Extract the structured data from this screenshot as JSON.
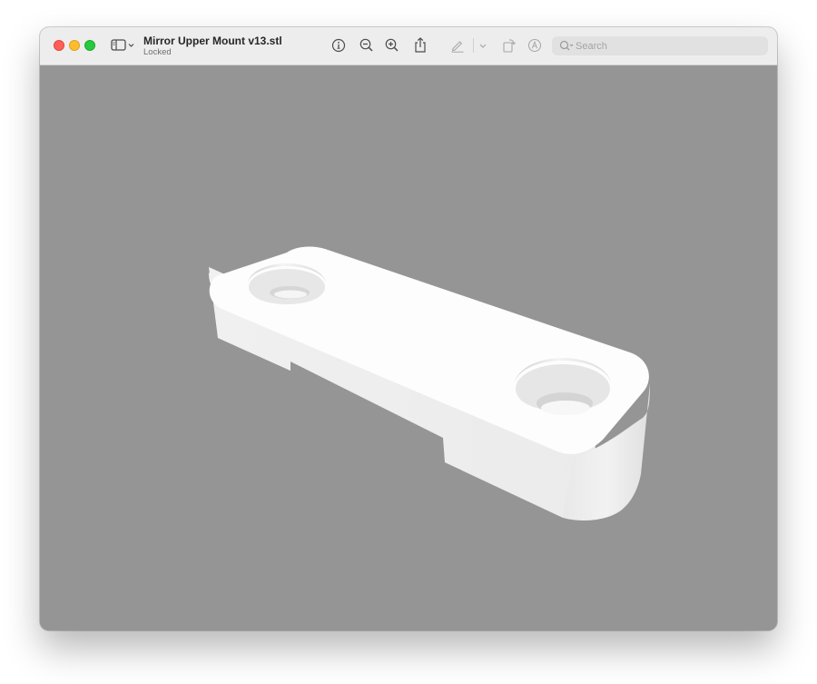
{
  "window": {
    "title": "Mirror Upper Mount v13.stl",
    "subtitle": "Locked"
  },
  "toolbar": {
    "buttons": [
      {
        "name": "info",
        "icon": "info-circle-icon"
      },
      {
        "name": "zoom-out",
        "icon": "zoom-out-icon"
      },
      {
        "name": "zoom-in",
        "icon": "zoom-in-icon"
      },
      {
        "name": "share",
        "icon": "share-icon"
      },
      {
        "name": "markup",
        "icon": "pen-icon",
        "enabled": false
      },
      {
        "name": "markup-menu",
        "icon": "chevron-down-icon",
        "enabled": false
      },
      {
        "name": "rotate",
        "icon": "rotate-icon",
        "enabled": false
      },
      {
        "name": "annotate",
        "icon": "annotate-circle-icon",
        "enabled": false
      }
    ]
  },
  "search": {
    "placeholder": "Search",
    "value": ""
  },
  "viewport": {
    "background": "#959595",
    "model": "3D mount part preview"
  },
  "colors": {
    "close": "#ff5f57",
    "minimize": "#febc2e",
    "zoom": "#28c840",
    "titlebar": "#ededed",
    "model_top": "#fdfdfd",
    "model_side": "#ededed"
  }
}
